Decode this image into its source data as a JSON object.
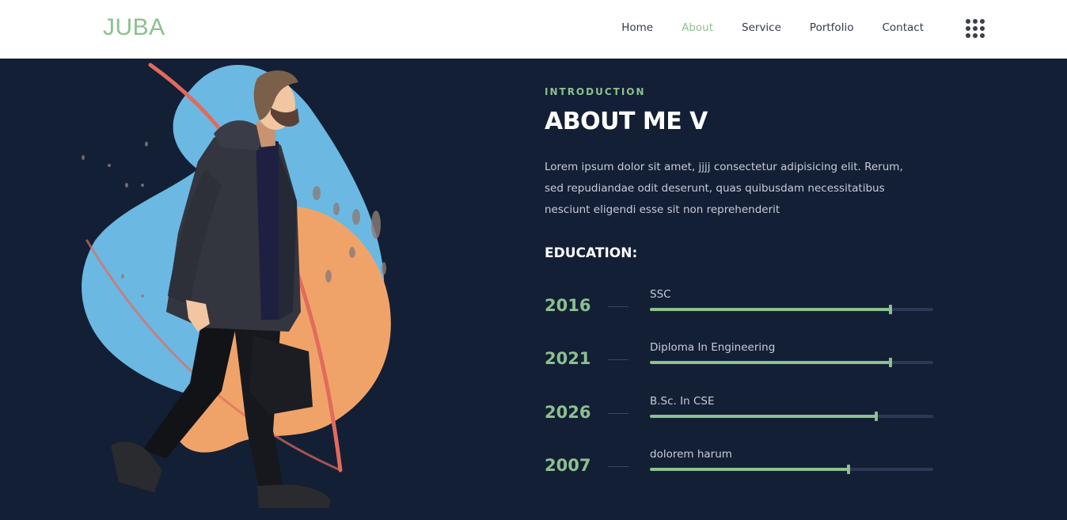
{
  "brand": {
    "logo": "JUBA"
  },
  "nav": {
    "items": [
      {
        "label": "Home",
        "active": false
      },
      {
        "label": "About",
        "active": true
      },
      {
        "label": "Service",
        "active": false
      },
      {
        "label": "Portfolio",
        "active": false
      },
      {
        "label": "Contact",
        "active": false
      }
    ],
    "menu_icon": "grid-menu-icon"
  },
  "about": {
    "eyebrow": "INTRODUCTION",
    "title": "ABOUT ME V",
    "intro": "Lorem ipsum dolor sit amet, jjjj consectetur adipisicing elit. Rerum, sed repudiandae odit deserunt, quas quibusdam necessitatibus nesciunt eligendi esse sit non reprehenderit",
    "education_title": "EDUCATION:",
    "education": [
      {
        "year": "2016",
        "label": "SSC",
        "progress": 0.85
      },
      {
        "year": "2021",
        "label": "Diploma In Engineering",
        "progress": 0.85
      },
      {
        "year": "2026",
        "label": "B.Sc. In CSE",
        "progress": 0.8
      },
      {
        "year": "2007",
        "label": "dolorem harum",
        "progress": 0.7
      }
    ]
  },
  "colors": {
    "accent": "#8cc08f",
    "background": "#131f35",
    "track": "#2f3756",
    "blob_blue": "#6bb8e3",
    "blob_orange": "#f0a369",
    "line_red": "#e26b5c"
  }
}
